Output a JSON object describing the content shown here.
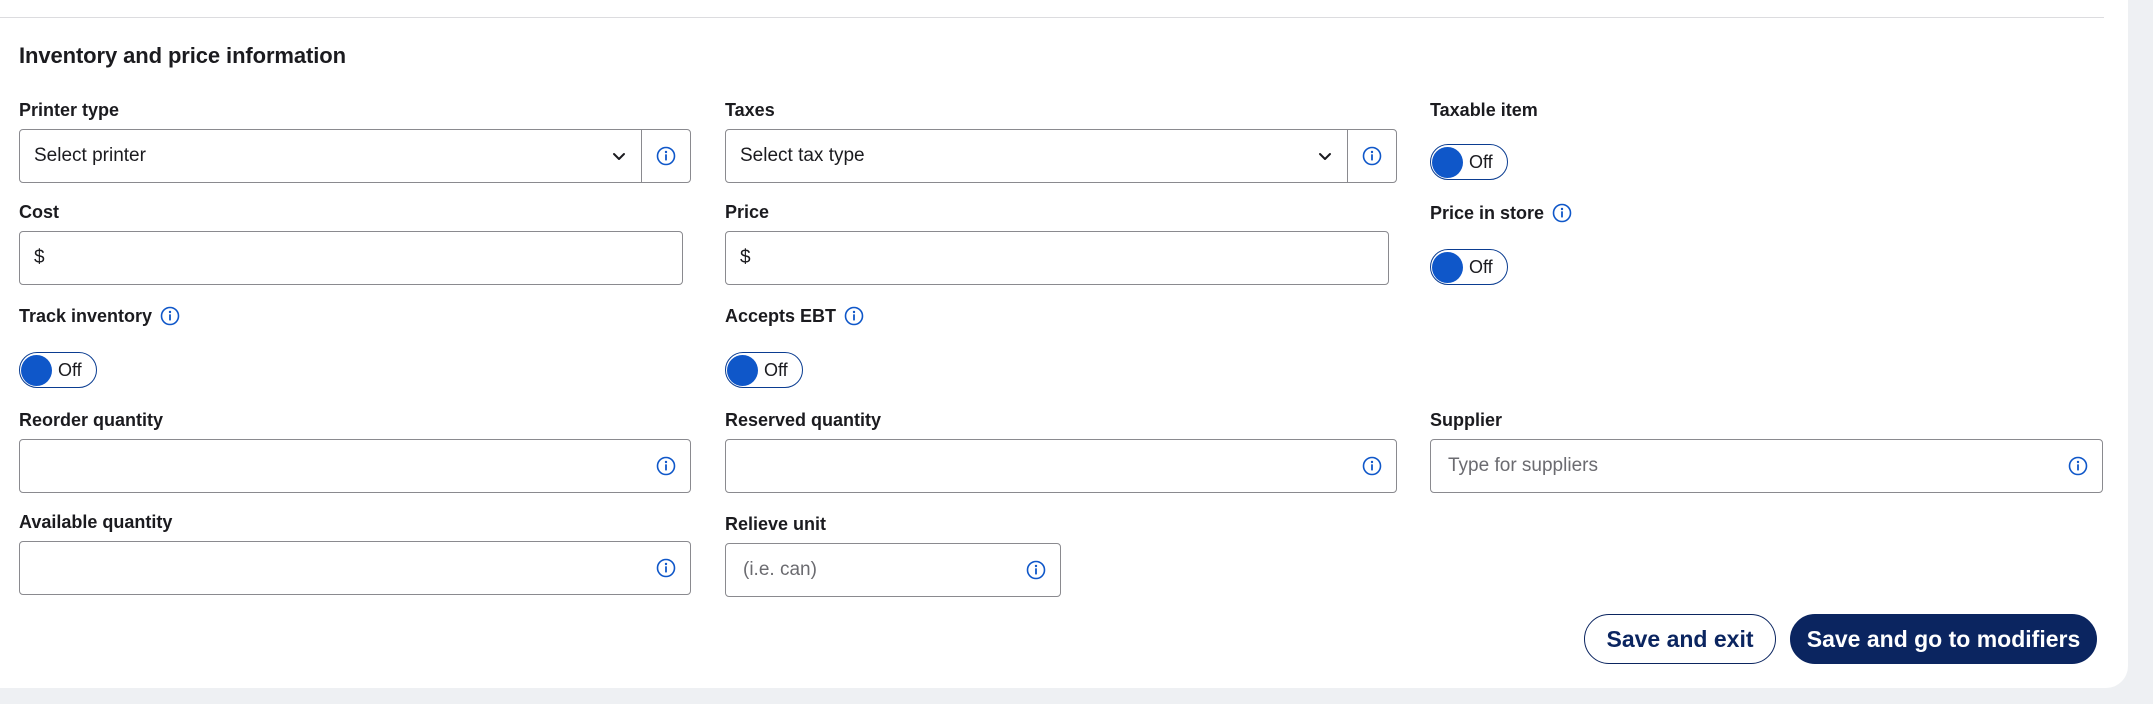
{
  "section": {
    "title": "Inventory and price information"
  },
  "fields": {
    "printer_type": {
      "label": "Printer type",
      "value": "Select printer"
    },
    "taxes": {
      "label": "Taxes",
      "value": "Select tax type"
    },
    "taxable_item": {
      "label": "Taxable item",
      "toggle": "Off"
    },
    "cost": {
      "label": "Cost",
      "prefix": "$",
      "value": ""
    },
    "price": {
      "label": "Price",
      "prefix": "$",
      "value": ""
    },
    "price_in_store": {
      "label": "Price in store",
      "toggle": "Off"
    },
    "track_inventory": {
      "label": "Track inventory",
      "toggle": "Off"
    },
    "accepts_ebt": {
      "label": "Accepts EBT",
      "toggle": "Off"
    },
    "reorder_quantity": {
      "label": "Reorder quantity",
      "value": ""
    },
    "reserved_quantity": {
      "label": "Reserved quantity",
      "value": ""
    },
    "supplier": {
      "label": "Supplier",
      "placeholder": "Type for suppliers"
    },
    "available_quantity": {
      "label": "Available quantity",
      "value": ""
    },
    "relieve_unit": {
      "label": "Relieve unit",
      "placeholder": "(i.e. can)"
    }
  },
  "actions": {
    "save_exit": "Save and exit",
    "save_modifiers": "Save and go to modifiers"
  },
  "colors": {
    "accent": "#0f57c9",
    "primary_dark": "#0b2560",
    "icon_blue": "#0f57c9"
  }
}
